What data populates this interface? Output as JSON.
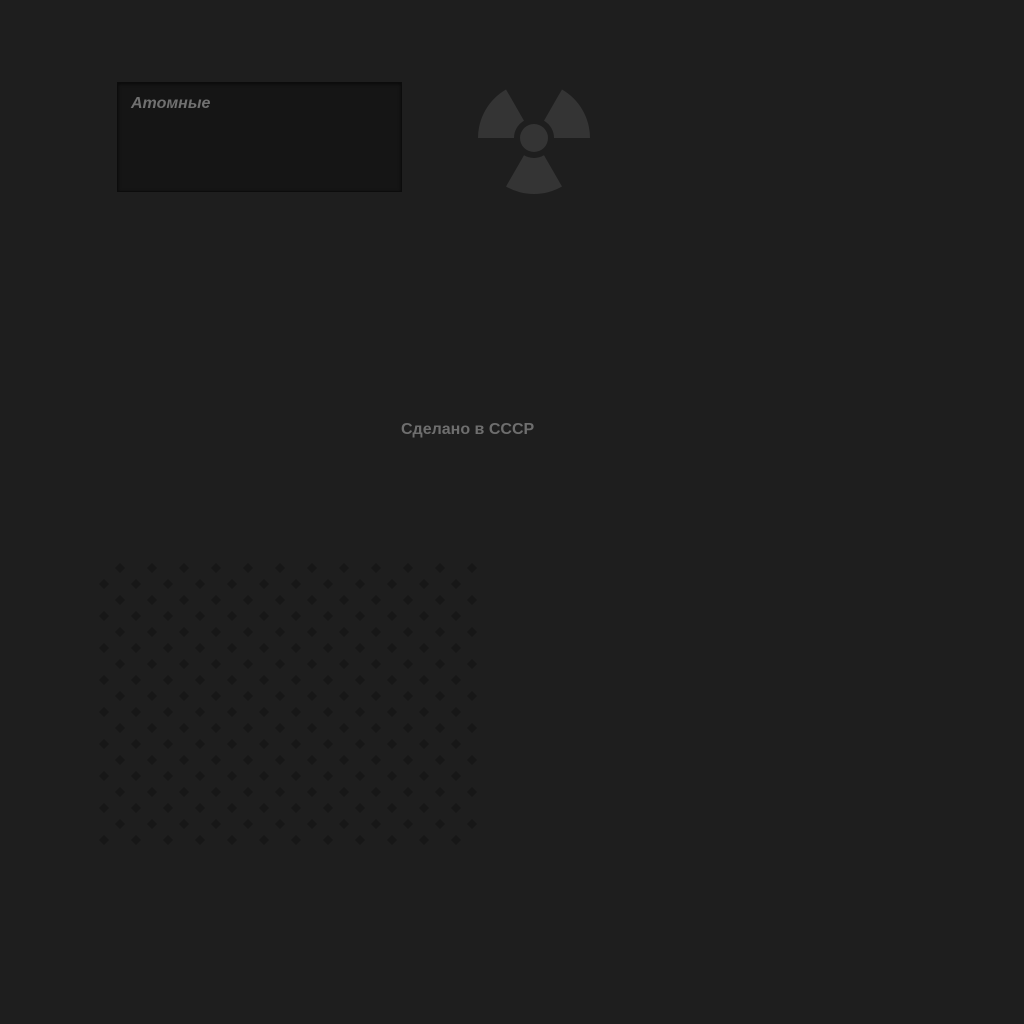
{
  "label_box": {
    "title": "Атомные"
  },
  "radiation_symbol": {
    "icon": "radiation-icon",
    "color": "#343434"
  },
  "footer": {
    "text": "Сделано в СССР"
  },
  "colors": {
    "background": "#1e1e1e",
    "panel": "#151515",
    "text": "#707070",
    "grille_dot": "#171717"
  }
}
